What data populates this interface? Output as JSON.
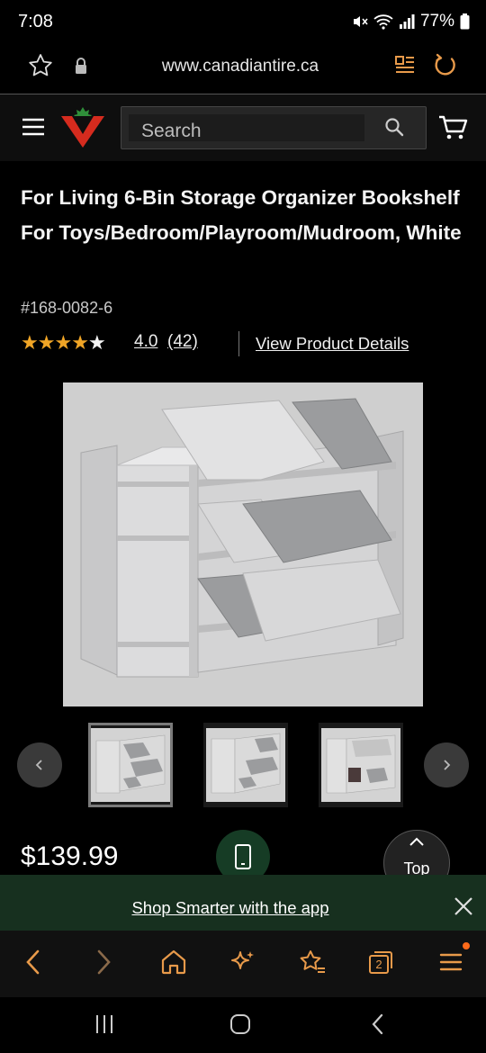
{
  "status_bar": {
    "time": "7:08",
    "battery": "77%"
  },
  "browser": {
    "url": "www.canadiantire.ca",
    "tabs_count": "2"
  },
  "header": {
    "search_placeholder": "Search"
  },
  "product": {
    "title": "For Living 6-Bin Storage Organizer Bookshelf For Toys/Bedroom/Playroom/Mudroom, White",
    "sku": "#168-0082-6",
    "rating_value": "4.0",
    "rating_count": "(42)",
    "rating_stars": 4,
    "details_link": "View Product Details",
    "price": "$139.99"
  },
  "floating": {
    "top_label": "Top"
  },
  "app_banner": {
    "text": "Shop Smarter with the app"
  },
  "colors": {
    "star": "#f0a526",
    "brand_red": "#d52b1e",
    "banner_green": "#17301f",
    "notification": "#ff6a1a"
  }
}
